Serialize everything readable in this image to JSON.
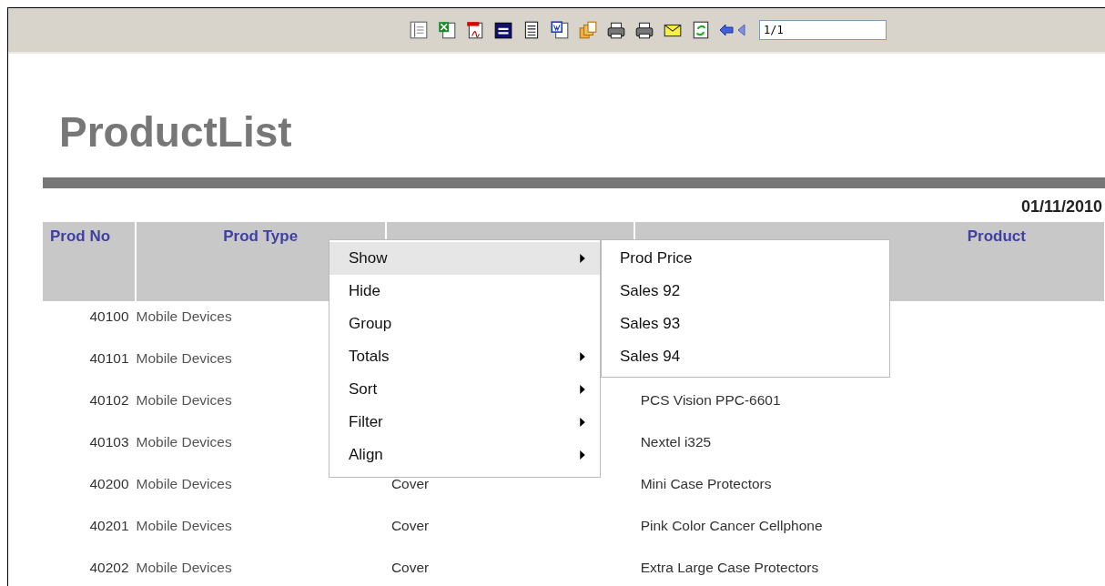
{
  "toolbar": {
    "page_field": "1/1"
  },
  "report": {
    "title": "ProductList",
    "date": "01/11/2010",
    "columns": [
      {
        "label": "Prod No"
      },
      {
        "label": "Prod Type"
      },
      {},
      {
        "label": "Product"
      }
    ],
    "rows": [
      {
        "prod_no": "40100",
        "prod_type": "Mobile Devices"
      },
      {
        "prod_no": "40101",
        "prod_type": "Mobile Devices"
      },
      {
        "prod_no": "40102",
        "prod_type": "Mobile Devices",
        "product": "PCS Vision PPC-6601"
      },
      {
        "prod_no": "40103",
        "prod_type": "Mobile Devices",
        "product": "Nextel i325"
      },
      {
        "prod_no": "40200",
        "prod_type": "Mobile Devices",
        "prod_line": "Cover",
        "product": "Mini Case Protectors"
      },
      {
        "prod_no": "40201",
        "prod_type": "Mobile Devices",
        "prod_line": "Cover",
        "product": "Pink Color Cancer Cellphone"
      },
      {
        "prod_no": "40202",
        "prod_type": "Mobile Devices",
        "prod_line": "Cover",
        "product": "Extra Large Case Protectors"
      }
    ]
  },
  "context_menu": {
    "items": [
      {
        "label": "Show",
        "submenu": true,
        "selected": true
      },
      {
        "label": "Hide",
        "submenu": false,
        "selected": false
      },
      {
        "label": "Group",
        "submenu": false,
        "selected": false
      },
      {
        "label": "Totals",
        "submenu": true,
        "selected": false
      },
      {
        "label": "Sort",
        "submenu": true,
        "selected": false
      },
      {
        "label": "Filter",
        "submenu": true,
        "selected": false
      },
      {
        "label": "Align",
        "submenu": true,
        "selected": false
      }
    ],
    "submenu": [
      {
        "label": "Prod Price"
      },
      {
        "label": "Sales 92"
      },
      {
        "label": "Sales 93"
      },
      {
        "label": "Sales 94"
      }
    ]
  }
}
